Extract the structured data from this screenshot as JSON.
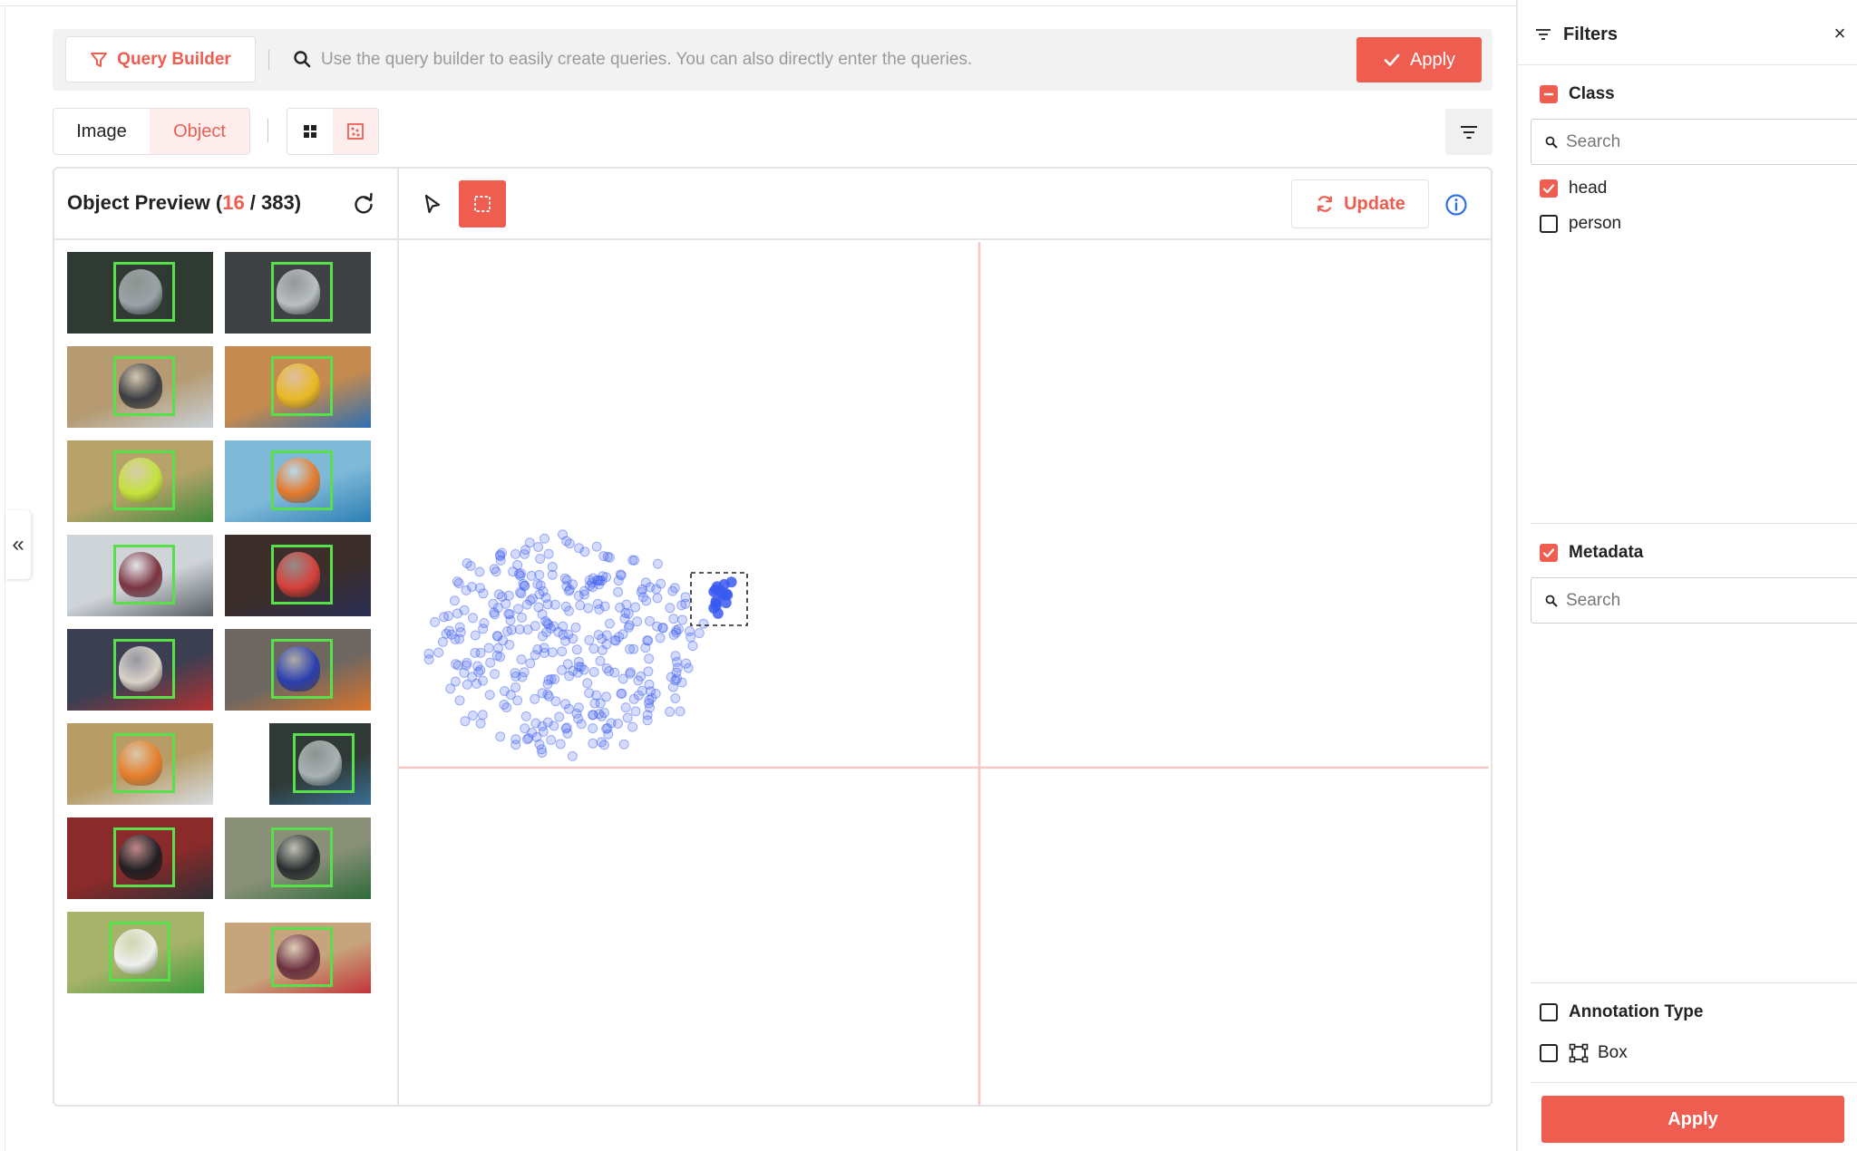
{
  "query_bar": {
    "builder_label": "Query Builder",
    "placeholder": "Use the query builder to easily create queries. You can also directly enter the queries.",
    "apply_label": "Apply"
  },
  "view_tabs": [
    {
      "label": "Image",
      "active": false
    },
    {
      "label": "Object",
      "active": true
    }
  ],
  "view_modes": [
    {
      "icon": "grid-view-icon",
      "active": false
    },
    {
      "icon": "embedding-view-icon",
      "active": true
    }
  ],
  "preview": {
    "title": "Object Preview",
    "open_paren": " (",
    "shown": "16",
    "separator": " / ",
    "total": "383",
    "close_paren": ")"
  },
  "viz_toolbar": {
    "update_label": "Update",
    "tools": [
      "pointer-tool-icon",
      "box-select-tool-icon"
    ],
    "active_tool": "box-select-tool-icon"
  },
  "filters": {
    "title": "Filters",
    "class_section": {
      "label": "Class",
      "state": "indeterminate",
      "search_placeholder": "Search",
      "options": [
        {
          "label": "head",
          "checked": true
        },
        {
          "label": "person",
          "checked": false
        }
      ]
    },
    "metadata_section": {
      "label": "Metadata",
      "checked": true,
      "search_placeholder": "Search"
    },
    "annotation_type_section": {
      "label": "Annotation Type",
      "checked": false,
      "options": [
        {
          "label": "Box",
          "icon": "box-annotation-icon",
          "checked": false
        }
      ]
    },
    "apply_label": "Apply"
  },
  "thumbnails": [
    {
      "helmet": "#9aa3a8",
      "bg": "#2f3a32",
      "jersey": "#2f3a32"
    },
    {
      "helmet": "#b8bec2",
      "bg": "#3e4244",
      "jersey": "#3e4244"
    },
    {
      "helmet": "#3a3d40",
      "bg": "#b59a72",
      "jersey": "#c9d2da"
    },
    {
      "helmet": "#e8b923",
      "bg": "#c58a4f",
      "jersey": "#2d6fb3"
    },
    {
      "helmet": "#c3e23a",
      "bg": "#b7a36a",
      "jersey": "#3f8a3a"
    },
    {
      "helmet": "#e4782a",
      "bg": "#7fb9d8",
      "jersey": "#2c7fb5"
    },
    {
      "helmet": "#7a3240",
      "bg": "#cfd4d8",
      "jersey": "#565d63"
    },
    {
      "helmet": "#d6403a",
      "bg": "#3c2e2a",
      "jersey": "#2a2f55"
    },
    {
      "helmet": "#d9d2c8",
      "bg": "#3c3f52",
      "jersey": "#b33232"
    },
    {
      "helmet": "#2a3fb0",
      "bg": "#6e6761",
      "jersey": "#d9752a"
    },
    {
      "helmet": "#e67d2b",
      "bg": "#b79c66",
      "jersey": "#d8dde2"
    },
    {
      "helmet": "#a9b2b4",
      "bg": "#2f3a36",
      "jersey": "#3a6d96"
    },
    {
      "helmet": "#1f1f22",
      "bg": "#8a2a2a",
      "jersey": "#2f2f35"
    },
    {
      "helmet": "#2a2d30",
      "bg": "#8a9078",
      "jersey": "#2d6b3a"
    },
    {
      "helmet": "#eef0ee",
      "bg": "#a7b26a",
      "jersey": "#3c9a3a"
    },
    {
      "helmet": "#6b3040",
      "bg": "#c7a57c",
      "jersey": "#c2343a"
    }
  ],
  "embedding_points": {
    "cluster_count": 383,
    "selected_count": 16
  },
  "colors": {
    "accent": "#ee5d50",
    "point": "#3a5bf0",
    "bbox": "#58e04a",
    "crosshair": "#f7c6c6"
  }
}
